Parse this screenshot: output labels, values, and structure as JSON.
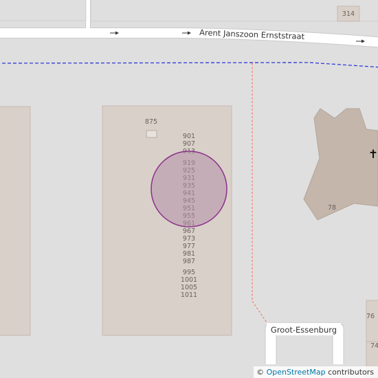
{
  "map": {
    "streets": {
      "top_street": "Arent Janszoon Ernststraat",
      "bottom_street": "Groot-Essenburg"
    },
    "buildings": {
      "top_right_number": "314",
      "church_number": "78",
      "right_lower_number_1": "76",
      "right_lower_number_2": "74",
      "main_block_number": "875",
      "main_block_house_numbers": [
        "901",
        "907",
        "913",
        "919",
        "925",
        "931",
        "935",
        "941",
        "945",
        "951",
        "955",
        "961",
        "967",
        "973",
        "977",
        "981",
        "987",
        "995",
        "1001",
        "1005",
        "1011"
      ]
    },
    "poi": {
      "church_symbol": "✝"
    },
    "colors": {
      "background": "#e0dfdf",
      "building": "#d9d0c9",
      "building_outline": "#c6b9b2",
      "church": "#c4b6ab",
      "road": "#ffffff",
      "boundary": "#2b3ad6",
      "footpath": "#fa8072",
      "marker_fill": "#b48fa8",
      "marker_stroke": "#8b2f8a"
    },
    "attribution": {
      "symbol": "©",
      "link_text": "OpenStreetMap",
      "suffix": "contributors"
    }
  }
}
